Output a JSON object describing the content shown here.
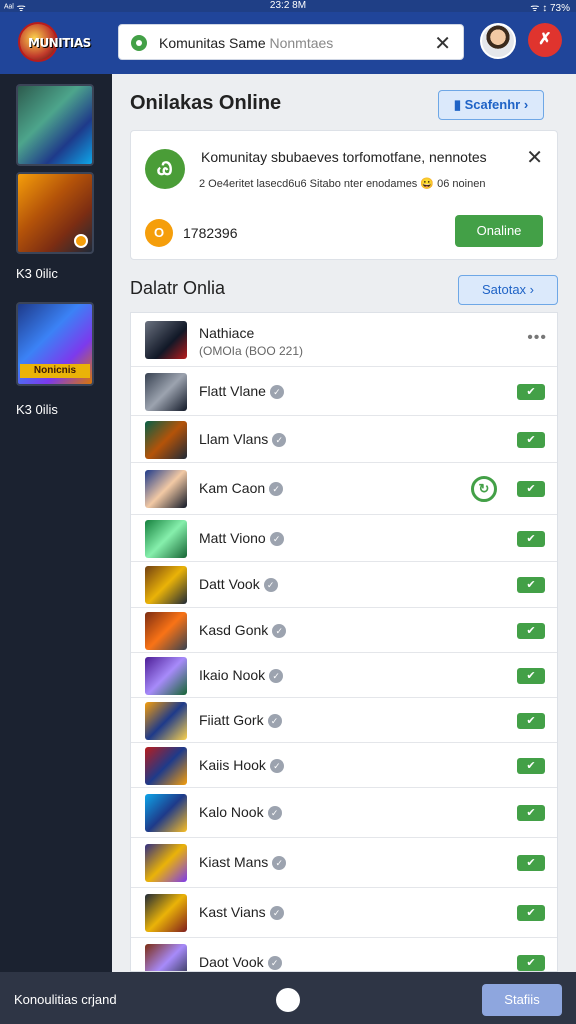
{
  "status_bar": {
    "left": "ᴬᵃˡ ᯤ",
    "time": "23:2 8M",
    "right": "ᯤ ↕ 73%"
  },
  "header": {
    "logo_text": "MUNITIAS",
    "search": {
      "value": "Komunitas Same",
      "placeholder": "Nonmtaes"
    }
  },
  "sidebar": {
    "items": [
      {
        "label": ""
      },
      {
        "label": "K3 0ilic"
      },
      {
        "label": "K3 0ilis",
        "banner": "Nonicnis"
      }
    ]
  },
  "online": {
    "title": "Onilakas Online",
    "button": "Scafenhr",
    "card": {
      "title": "Komunitay sbubaeves torfomotfane, nennotes",
      "subtitle": "2 Oe4eritet lasecd6u6 Sitabo nter enodames 😀 06 noinen",
      "count": "1782396",
      "count_badge": "O",
      "cta": "Onaline",
      "icon_glyph": "Ꮚ"
    }
  },
  "list_section": {
    "title": "Dalatr Onlia",
    "button": "Satotax",
    "header": {
      "name": "Nathiace",
      "sub": "(OMOIa (BOO 221)"
    },
    "rows": [
      {
        "name": "Flatt Vlane"
      },
      {
        "name": "Llam Vlans"
      },
      {
        "name": "Kam Caon"
      },
      {
        "name": "Matt Viono"
      },
      {
        "name": "Datt Vook"
      },
      {
        "name": "Kasd Gonk"
      },
      {
        "name": "Ikaio Nook"
      },
      {
        "name": "Fiiatt Gork"
      },
      {
        "name": "Kaiis Hook"
      },
      {
        "name": "Kalo Nook"
      },
      {
        "name": "Kiast Mans"
      },
      {
        "name": "Kast Vians"
      },
      {
        "name": "Daot Vook"
      }
    ]
  },
  "bottom_bar": {
    "label": "Konoulitias crjand",
    "button": "Stafiis"
  }
}
